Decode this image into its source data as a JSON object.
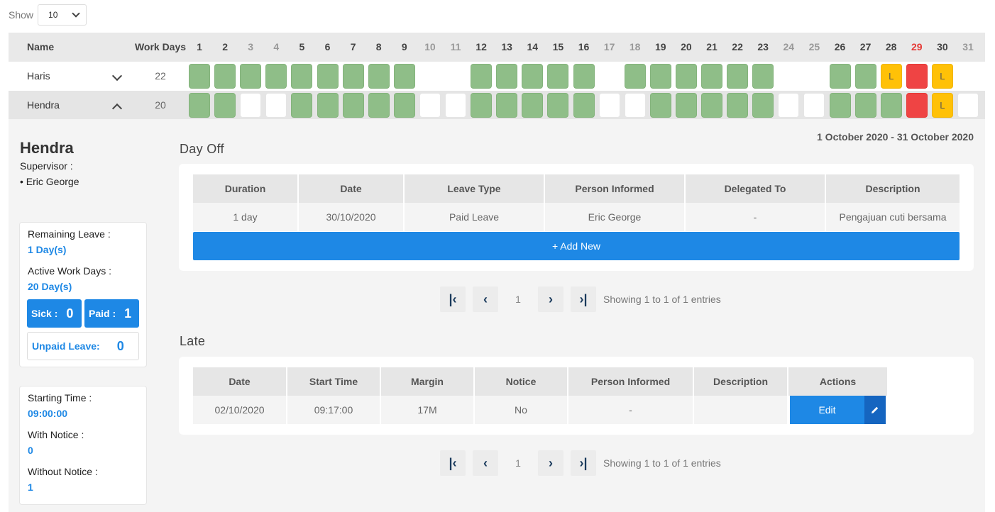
{
  "show": {
    "label": "Show",
    "value": "10"
  },
  "grid": {
    "header": {
      "name": "Name",
      "work_days": "Work Days"
    },
    "days": [
      {
        "n": "1",
        "t": ""
      },
      {
        "n": "2",
        "t": ""
      },
      {
        "n": "3",
        "t": "weekend"
      },
      {
        "n": "4",
        "t": "weekend"
      },
      {
        "n": "5",
        "t": ""
      },
      {
        "n": "6",
        "t": ""
      },
      {
        "n": "7",
        "t": ""
      },
      {
        "n": "8",
        "t": ""
      },
      {
        "n": "9",
        "t": ""
      },
      {
        "n": "10",
        "t": "weekend"
      },
      {
        "n": "11",
        "t": "weekend"
      },
      {
        "n": "12",
        "t": ""
      },
      {
        "n": "13",
        "t": ""
      },
      {
        "n": "14",
        "t": ""
      },
      {
        "n": "15",
        "t": ""
      },
      {
        "n": "16",
        "t": ""
      },
      {
        "n": "17",
        "t": "weekend"
      },
      {
        "n": "18",
        "t": "weekend"
      },
      {
        "n": "19",
        "t": ""
      },
      {
        "n": "20",
        "t": ""
      },
      {
        "n": "21",
        "t": ""
      },
      {
        "n": "22",
        "t": ""
      },
      {
        "n": "23",
        "t": ""
      },
      {
        "n": "24",
        "t": "weekend"
      },
      {
        "n": "25",
        "t": "weekend"
      },
      {
        "n": "26",
        "t": ""
      },
      {
        "n": "27",
        "t": ""
      },
      {
        "n": "28",
        "t": ""
      },
      {
        "n": "29",
        "t": "holiday"
      },
      {
        "n": "30",
        "t": ""
      },
      {
        "n": "31",
        "t": "weekend"
      }
    ],
    "employees": [
      {
        "name": "Haris",
        "work_days": "22",
        "expanded": false,
        "cells": [
          "work",
          "work",
          "work",
          "work",
          "work",
          "work",
          "work",
          "work",
          "work",
          "none",
          "none",
          "work",
          "work",
          "work",
          "work",
          "work",
          "none",
          "work",
          "work",
          "work",
          "work",
          "work",
          "work",
          "none",
          "none",
          "work",
          "work",
          "late",
          "off",
          "late",
          "none"
        ]
      },
      {
        "name": "Hendra",
        "work_days": "20",
        "expanded": true,
        "cells": [
          "work",
          "work",
          "empty",
          "empty",
          "work",
          "work",
          "work",
          "work",
          "work",
          "empty",
          "empty",
          "work",
          "work",
          "work",
          "work",
          "work",
          "empty",
          "empty",
          "work",
          "work",
          "work",
          "work",
          "work",
          "empty",
          "empty",
          "work",
          "work",
          "work",
          "off",
          "late",
          "empty"
        ]
      }
    ],
    "late_mark": "L"
  },
  "detail": {
    "name": "Hendra",
    "supervisor_label": "Supervisor :",
    "supervisor": "• Eric George",
    "remaining_leave_label": "Remaining Leave :",
    "remaining_leave": "1 Day(s)",
    "active_work_days_label": "Active Work Days :",
    "active_work_days": "20 Day(s)",
    "sick_label": "Sick :",
    "sick": "0",
    "paid_label": "Paid :",
    "paid": "1",
    "unpaid_label": "Unpaid Leave:",
    "unpaid": "0",
    "starting_time_label": "Starting Time :",
    "starting_time": "09:00:00",
    "with_notice_label": "With Notice :",
    "with_notice": "0",
    "without_notice_label": "Without Notice :",
    "without_notice": "1",
    "period": "1 October 2020 - 31 October 2020"
  },
  "day_off": {
    "title": "Day Off",
    "columns": [
      "Duration",
      "Date",
      "Leave Type",
      "Person Informed",
      "Delegated To",
      "Description"
    ],
    "rows": [
      [
        "1 day",
        "30/10/2020",
        "Paid Leave",
        "Eric George",
        "-",
        "Pengajuan cuti bersama"
      ]
    ],
    "add_label": "+ Add New",
    "pager": {
      "page": "1",
      "info": "Showing 1 to 1 of 1 entries"
    }
  },
  "late": {
    "title": "Late",
    "columns": [
      "Date",
      "Start Time",
      "Margin",
      "Notice",
      "Person Informed",
      "Description",
      "Actions"
    ],
    "rows": [
      [
        "02/10/2020",
        "09:17:00",
        "17M",
        "No",
        "-",
        ""
      ]
    ],
    "edit_label": "Edit",
    "pager": {
      "page": "1",
      "info": "Showing 1 to 1 of 1 entries"
    }
  }
}
